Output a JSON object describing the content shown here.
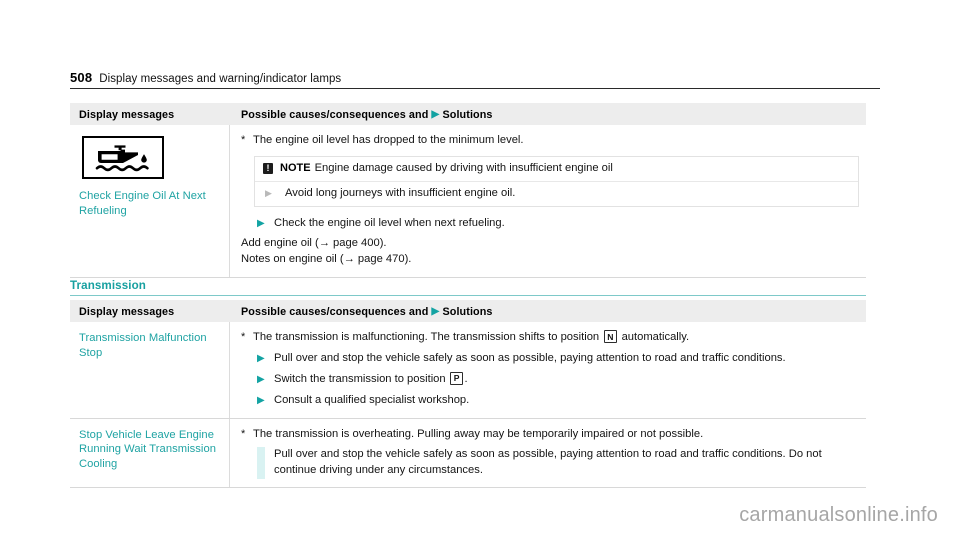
{
  "running_head": {
    "page_number": "508",
    "chapter": "Display messages and warning/indicator lamps"
  },
  "table1": {
    "headers": {
      "col_a": "Display messages",
      "col_b_pre": "Possible causes/consequences and",
      "col_b_marker": "▶",
      "col_b_post": "Solutions"
    },
    "rows": [
      {
        "icon": "engine-oil-level-lamp-icon",
        "message": "Check Engine Oil At Next Refueling",
        "cause_marker": "*",
        "cause": "The engine oil level has dropped to the minimum level.",
        "note": {
          "badge": "!",
          "keyword": "NOTE",
          "text": "Engine damage caused by driving with insufficient engine oil",
          "action_marker": "▶",
          "action": "Avoid long journeys with insufficient engine oil."
        },
        "solutions": [
          {
            "marker": "▶",
            "text": "Check the engine oil level when next refueling."
          }
        ],
        "plain_lines": [
          "Add engine oil (→ page 400).",
          "Notes on engine oil (→ page 470)."
        ]
      }
    ]
  },
  "section": {
    "title": "Transmission"
  },
  "table2": {
    "headers": {
      "col_a": "Display messages",
      "col_b_pre": "Possible causes/consequences and",
      "col_b_marker": "▶",
      "col_b_post": "Solutions"
    },
    "rows": [
      {
        "message": "Transmission Malfunction Stop",
        "cause_marker": "*",
        "cause_part1": "The transmission is malfunctioning. The transmission shifts to position",
        "cause_gear": "N",
        "cause_part2": "automatically.",
        "solutions": [
          {
            "marker": "▶",
            "text": "Pull over and stop the vehicle safely as soon as possible, paying attention to road and traffic conditions."
          },
          {
            "marker": "▶",
            "text_part1": "Switch the transmission to position",
            "gear": "P",
            "text_part2": "."
          },
          {
            "marker": "▶",
            "text": "Consult a qualified specialist workshop."
          }
        ]
      },
      {
        "message": "Stop Vehicle Leave Engine Running Wait Transmission Cooling",
        "cause_marker": "*",
        "cause": "The transmission is overheating. Pulling away may be temporarily impaired or not possible.",
        "solutions": [
          {
            "marker": "▶",
            "text": "Pull over and stop the vehicle safely as soon as possible, paying attention to road and traffic conditions. Do not continue driving under any circumstances.",
            "highlighted": true
          }
        ]
      }
    ]
  },
  "watermark": "carmanualsonline.info",
  "colors": {
    "teal": "#1fa3a3",
    "heading_teal": "#17a0a0",
    "header_bg": "#ededed",
    "rule_dark": "#2a2a2a",
    "highlight_bar": "#d9f2f2"
  }
}
